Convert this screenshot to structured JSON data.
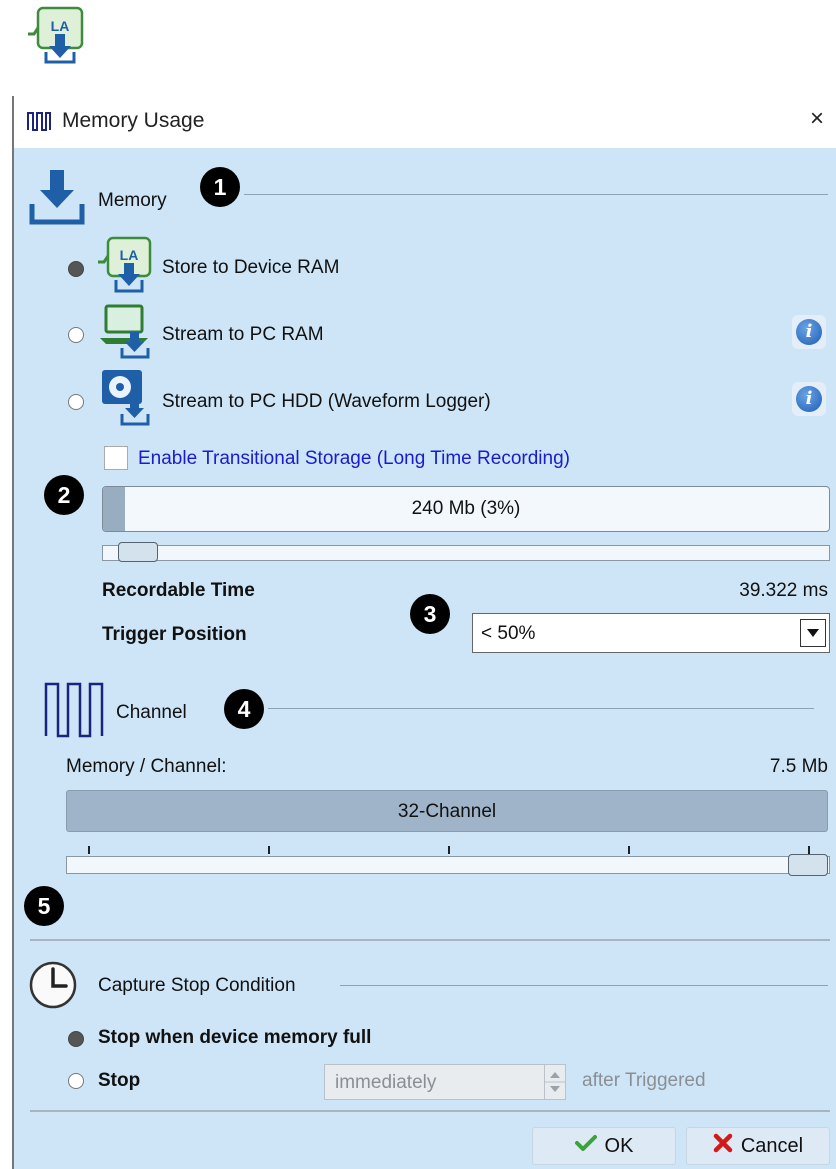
{
  "window": {
    "title": "Memory Usage",
    "close_label": "×"
  },
  "icons": {
    "app": "logic-analyzer-download-icon",
    "title": "pulse-waveform-icon",
    "memory": "download-tray-icon",
    "device_ram": "logic-analyzer-download-icon",
    "pc_ram": "laptop-download-icon",
    "pc_hdd": "hard-drive-download-icon",
    "info": "info-icon",
    "channel": "pulse-waveform-icon",
    "clock": "clock-icon",
    "ok": "checkmark-icon",
    "cancel": "x-icon"
  },
  "badges": [
    "1",
    "2",
    "3",
    "4",
    "5"
  ],
  "memory": {
    "section_label": "Memory",
    "options": [
      {
        "label": "Store to Device RAM",
        "selected": true
      },
      {
        "label": "Stream to PC RAM",
        "selected": false
      },
      {
        "label": "Stream to PC HDD (Waveform Logger)",
        "selected": false
      }
    ],
    "transitional_storage": {
      "label": "Enable Transitional Storage (Long Time Recording)",
      "checked": false
    },
    "usage_text": "240 Mb (3%)",
    "usage_percent": 3,
    "recordable_time_label": "Recordable Time",
    "recordable_time_value": "39.322 ms",
    "trigger_position_label": "Trigger Position",
    "trigger_position_value": "< 50%"
  },
  "channel": {
    "section_label": "Channel",
    "memory_per_channel_label": "Memory / Channel:",
    "memory_per_channel_value": "7.5 Mb",
    "mode_label": "32-Channel",
    "slider_level": 1.0
  },
  "capture": {
    "section_label": "Capture Stop Condition",
    "option_full": {
      "label": "Stop when device memory full",
      "selected": true
    },
    "option_stop": {
      "label": "Stop",
      "selected": false
    },
    "stop_mode_value": "immediately",
    "after_label": "after Triggered"
  },
  "buttons": {
    "ok": "OK",
    "cancel": "Cancel"
  },
  "colors": {
    "dialog_bg": "#cde5f7",
    "link": "#1a1ad0",
    "badge": "#000000",
    "ok_check": "#3aa33a",
    "cancel_x": "#d11a1a",
    "accent_blue": "#1f5fa8"
  }
}
